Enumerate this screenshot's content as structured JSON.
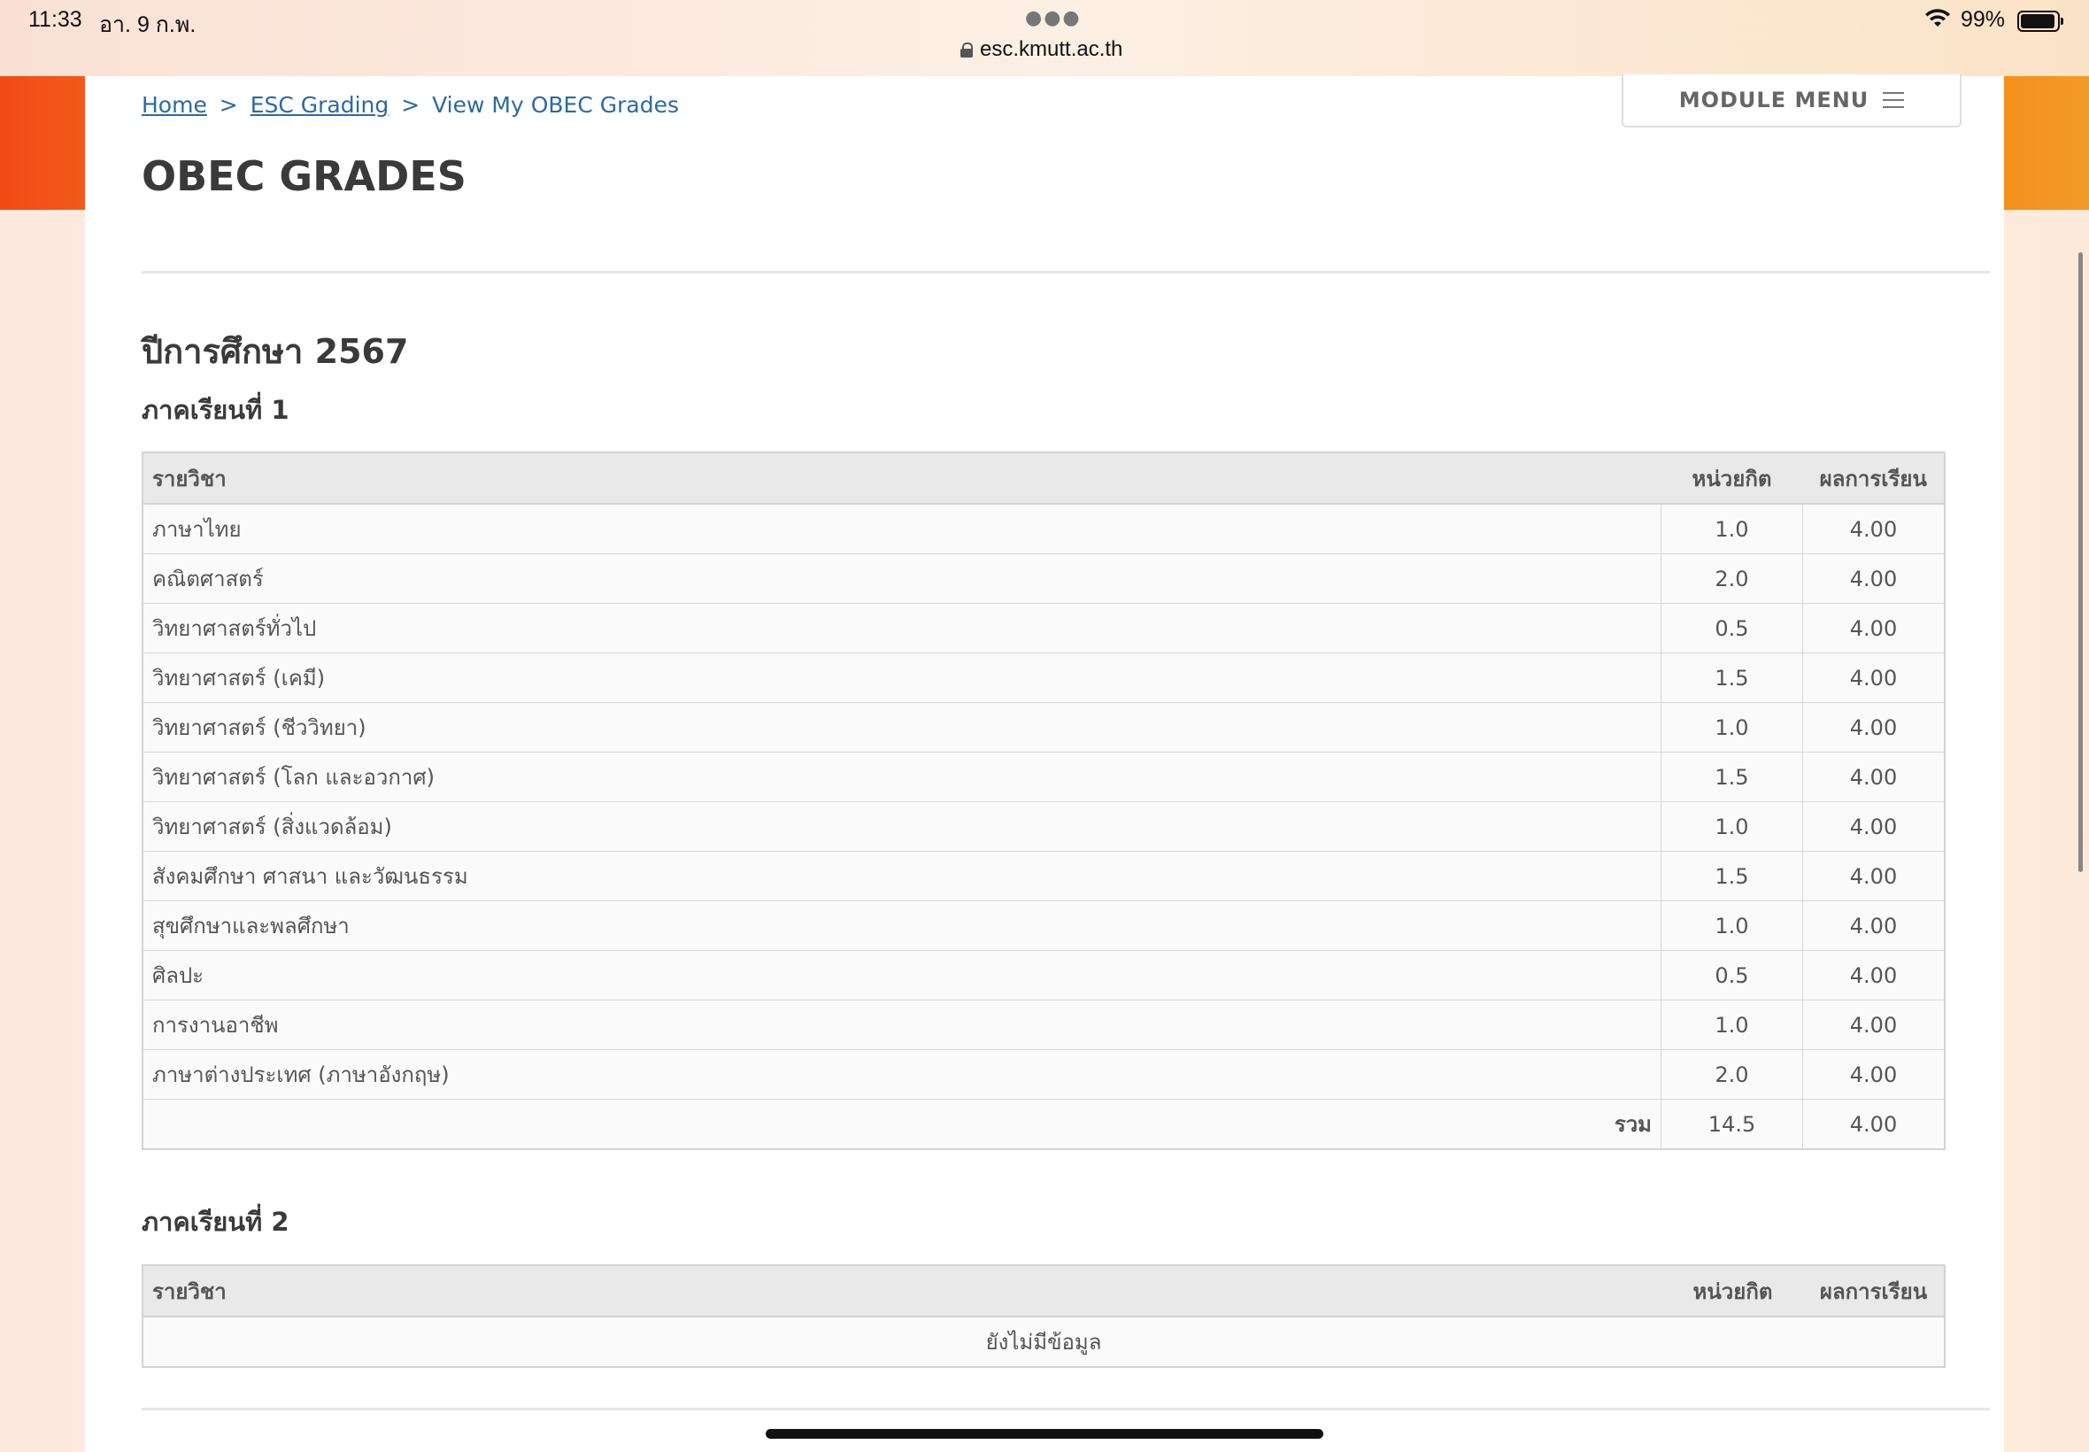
{
  "status_bar": {
    "time": "11:33",
    "date": "อา. 9 ก.พ.",
    "url": "esc.kmutt.ac.th",
    "battery": "99%"
  },
  "breadcrumb": {
    "home": "Home",
    "esc_grading": "ESC Grading",
    "current": "View My OBEC Grades",
    "separator": ">"
  },
  "module_menu": {
    "label": "MODULE MENU"
  },
  "page_title": "OBEC GRADES",
  "year_title": "ปีการศึกษา 2567",
  "semesters": [
    {
      "title": "ภาคเรียนที่ 1",
      "headers": {
        "subject": "รายวิชา",
        "credits": "หน่วยกิต",
        "grade": "ผลการเรียน"
      },
      "rows": [
        {
          "subject": "ภาษาไทย",
          "credits": "1.0",
          "grade": "4.00"
        },
        {
          "subject": "คณิตศาสตร์",
          "credits": "2.0",
          "grade": "4.00"
        },
        {
          "subject": "วิทยาศาสตร์ทั่วไป",
          "credits": "0.5",
          "grade": "4.00"
        },
        {
          "subject": "วิทยาศาสตร์ (เคมี)",
          "credits": "1.5",
          "grade": "4.00"
        },
        {
          "subject": "วิทยาศาสตร์ (ชีววิทยา)",
          "credits": "1.0",
          "grade": "4.00"
        },
        {
          "subject": "วิทยาศาสตร์ (โลก และอวกาศ)",
          "credits": "1.5",
          "grade": "4.00"
        },
        {
          "subject": "วิทยาศาสตร์ (สิ่งแวดล้อม)",
          "credits": "1.0",
          "grade": "4.00"
        },
        {
          "subject": "สังคมศึกษา ศาสนา และวัฒนธรรม",
          "credits": "1.5",
          "grade": "4.00"
        },
        {
          "subject": "สุขศึกษาและพลศึกษา",
          "credits": "1.0",
          "grade": "4.00"
        },
        {
          "subject": "ศิลปะ",
          "credits": "0.5",
          "grade": "4.00"
        },
        {
          "subject": "การงานอาชีพ",
          "credits": "1.0",
          "grade": "4.00"
        },
        {
          "subject": "ภาษาต่างประเทศ (ภาษาอังกฤษ)",
          "credits": "2.0",
          "grade": "4.00"
        }
      ],
      "total": {
        "label": "รวม",
        "credits": "14.5",
        "grade": "4.00"
      }
    },
    {
      "title": "ภาคเรียนที่ 2",
      "headers": {
        "subject": "รายวิชา",
        "credits": "หน่วยกิต",
        "grade": "ผลการเรียน"
      },
      "empty_message": "ยังไม่มีข้อมูล"
    }
  ]
}
